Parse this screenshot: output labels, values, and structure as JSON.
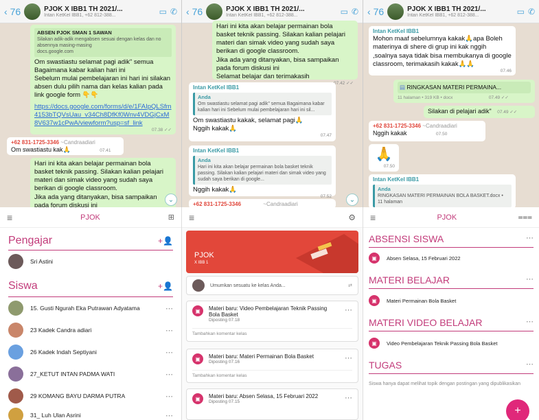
{
  "wa": {
    "back": "76",
    "title": "PJOK X IBB1 TH 2021/...",
    "subtitles": [
      "Intan KetKel IBB1, +62 812-388...",
      "Intan KetKel IBB1, +62 812-388...",
      "Intan KetKel IBB1, +62 812-388..."
    ]
  },
  "c1": {
    "quote_title": "ABSEN PJOK SMAN 1 SAWAN",
    "quote_line": "Silakan adik-adik mengabsen sesuai dengan kelas dan no absennya masing-masing",
    "quote_domain": "docs.google.com",
    "msg1": "Om swastiastu selamat pagi adik\" semua\nBagaimana kabar kalian hari ini\nSebelum mulai pembelajaran ini hari ini silakan absen dulu pilih nama dan kelas kalian pada link google form 👇👇",
    "link": "https://docs.google.com/forms/d/e/1FAIpQLSfm4153bTQVsUau_v34Ch8DfKf0Wnv4VDGjCxM8V637w1cPwA/viewform?usp=sf_link",
    "time1": "07.38 ✓✓",
    "sender2": "+62 831-1725-3346",
    "sender2_name": "~Candraadiari",
    "msg2": "Om swastiastu kak🙏",
    "time2": "07.41",
    "msg3": "Hari ini kita akan belajar permainan bola basket teknik passing. Silakan kalian pelajari materi dan simak video yang sudah saya berikan di google classroom.\nJika ada yang ditanyakan, bisa sampaikan pada forum diskusi ini\nSelamat belajar dan terimakasih"
  },
  "c2": {
    "msg1": "Hari ini kita akan belajar permainan bola basket teknik passing. Silakan kalian pelajari materi dan simak video yang sudah saya berikan di google classroom.\nJika ada yang ditanyakan, bisa sampaikan pada forum diskusi ini\nSelamat belajar dan terimakasih",
    "time1": "07.42 ✓✓",
    "sender": "Intan KetKel IBB1",
    "q_name": "Anda",
    "q1": "Om swastiastu selamat pagi adik\" semua Bagaimana kabar kalian hari ini Sebelum mulai pembelajaran hari ini sil...",
    "reply1": "Om swastiastu kakak, selamat pagi🙏\nNggih kakak🙏",
    "time2": "07.47",
    "q2": "Hari ini kita akan belajar permainan bola basket teknik passing. Silakan kalian pelajari materi dan simak video yang sudah saya berikan di google...",
    "reply2": "Nggih kakak🙏",
    "time3": "07.52",
    "sender2": "+62 831-1725-3346",
    "sender2_name": "~Candraadiari"
  },
  "c3": {
    "sender": "Intan KetKel IBB1",
    "msg1": "Mohon maaf sebelumnya kakak🙏apa Boleh materinya di shere di grup ini kak nggih ,soalnya saya tidak bisa membukanya di google classroom, terimakasih kakak🙏🙏",
    "time1": "07.46",
    "doc_name": "RINGKASAN MATERI PERMAINA...",
    "doc_meta": "11 halaman • 319 KB • docx",
    "doc_time": "07.49 ✓✓",
    "msg2": "Silakan di pelajari adik\"",
    "time2": "07.49 ✓✓",
    "sender2": "+62 831-1725-3346",
    "sender2_name": "~Candraadiari",
    "msg3": "Nggih kakak",
    "time3": "07.50",
    "emoji": "🙏",
    "time4": "07.50",
    "sender3": "Intan KetKel IBB1",
    "q_name": "Anda",
    "q_doc": "RINGKASAN MATERI PERMAINAN BOLA BASKET.docx • 11 halaman"
  },
  "p1": {
    "title": "PJOK",
    "teachers": "Pengajar",
    "teacher": "Sri Astini",
    "students": "Siswa",
    "list": [
      "15. Gusti Ngurah Eka Putrawan Adyatama",
      "23 Kadek Candra adiari",
      "26 Kadek Indah Septiyani",
      "27_KETUT INTAN PADMA WATI",
      "29 KOMANG BAYU DARMA PUTRA",
      "31_ Luh Ulan Asrini"
    ]
  },
  "p2": {
    "class_name": "PJOK",
    "section": "X IBB 1",
    "announce": "Umumkan sesuatu ke kelas Anda...",
    "posts": [
      {
        "title": "Materi baru: Video Pembelajaran Teknik Passing Bola Basket",
        "time": "Diposting 07.18",
        "comment": "Tambahkan komentar kelas"
      },
      {
        "title": "Materi baru: Materi Permainan Bola Basket",
        "time": "Diposting 07.16",
        "comment": "Tambahkan komentar kelas"
      },
      {
        "title": "Materi baru: Absen Selasa, 15 Februari 2022",
        "time": "Diposting 07.15"
      }
    ]
  },
  "p3": {
    "title": "PJOK",
    "t1": "ABSENSI SISWA",
    "i1": "Absen Selasa, 15 Februari 2022",
    "t2": "MATERI BELAJAR",
    "i2": "Materi Permainan Bola Basket",
    "t3": "MATERI VIDEO BELAJAR",
    "i3": "Video Pembelajaran Teknik Passing Bola Basket",
    "t4": "TUGAS",
    "i4": "Siswa hanya dapat melihat topik dengan postingan yang dipublikasikan",
    "fab": "+"
  }
}
